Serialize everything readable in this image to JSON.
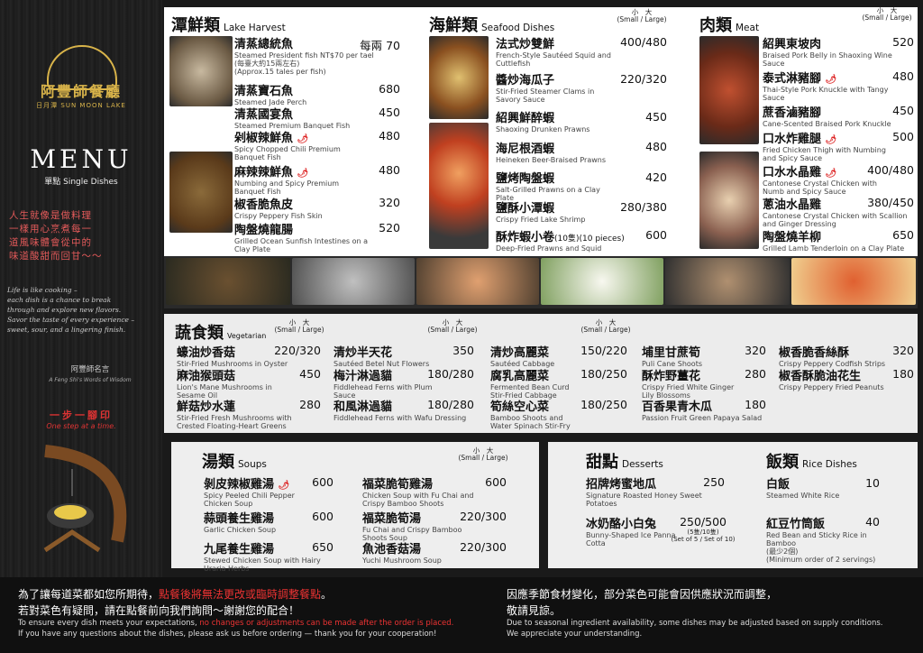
{
  "brand": {
    "name": "阿豐師餐廳",
    "sub": "日月潭 SUN MOON LAKE"
  },
  "menu": {
    "title": "MENU",
    "subtitle": "單點 Single Dishes"
  },
  "poem": {
    "zh": [
      "人生就像是做料理",
      "一樣用心烹煮每一",
      "道風味體會從中的",
      "味道酸甜而回甘～～"
    ],
    "en": [
      "Life is like cooking –",
      "each dish is a chance to break",
      "through and explore new flavors.",
      "Savor the taste of every experience –",
      "sweet, sour, and a lingering finish."
    ]
  },
  "signature": {
    "zh": "阿豐師名言",
    "en": "A Feng Shi's Words of Wisdom"
  },
  "step": {
    "zh": "一步一腳印",
    "en": "One step at a time."
  },
  "sections": {
    "lake": {
      "title": "潭鮮類",
      "title_en": "Lake Harvest",
      "items": [
        {
          "name": "清蒸總統魚",
          "en": "Steamed President fish  NT$70 per tael",
          "price": "每兩 70",
          "note": "(每臺大約15兩左右)",
          "note_en": "(Approx.15 tales per fish)"
        },
        {
          "name": "清蒸寶石魚",
          "en": "Steamed Jade Perch",
          "price": "680"
        },
        {
          "name": "清蒸國宴魚",
          "en": "Steamed Premium Banquet Fish",
          "price": "450"
        },
        {
          "name": "剁椒辣鮮魚",
          "en": "Spicy Chopped Chili Premium Banquet Fish",
          "price": "480",
          "spicy": true
        },
        {
          "name": "麻辣辣鮮魚",
          "en": "Numbing and Spicy Premium Banquet Fish",
          "price": "480",
          "spicy": true
        },
        {
          "name": "椒香脆魚皮",
          "en": "Crispy Peppery Fish Skin",
          "price": "320"
        },
        {
          "name": "陶盤燒龍腸",
          "en": "Grilled Ocean Sunfish Intestines on a Clay Plate",
          "price": "520"
        }
      ]
    },
    "seafood": {
      "title": "海鮮類",
      "title_en": "Seafood Dishes",
      "size_header": [
        "小　大",
        "(Small / Large)"
      ],
      "items": [
        {
          "name": "法式炒雙鮮",
          "en": "French-Style Sautéed Squid and Cuttlefish",
          "price": "400/480"
        },
        {
          "name": "醬炒海瓜子",
          "en": "Stir-Fried Steamer Clams in Savory Sauce",
          "price": "220/320"
        },
        {
          "name": "紹興鮮醉蝦",
          "en": "Shaoxing Drunken Prawns",
          "price": "450"
        },
        {
          "name": "海尼根酒蝦",
          "en": "Heineken Beer-Braised Prawns",
          "price": "480"
        },
        {
          "name": "鹽烤陶盤蝦",
          "en": "Salt-Grilled Prawns on a Clay Plate",
          "price": "420"
        },
        {
          "name": "鹽酥小潭蝦",
          "en": "Crispy Fried Lake Shrimp",
          "price": "280/380"
        },
        {
          "name": "酥炸蝦小卷",
          "qty": "(10隻)(10 pieces)",
          "en": "Deep-Fried Prawns and Squid",
          "price": "600"
        }
      ]
    },
    "meat": {
      "title": "肉類",
      "title_en": "Meat",
      "size_header": [
        "小　大",
        "(Small / Large)"
      ],
      "items": [
        {
          "name": "紹興東坡肉",
          "en": "Braised Pork Belly in Shaoxing Wine Sauce",
          "price": "520"
        },
        {
          "name": "泰式淋豬腳",
          "en": "Thai-Style Pork Knuckle with Tangy Sauce",
          "price": "480",
          "spicy": true
        },
        {
          "name": "蔗香滷豬腳",
          "en": "Cane-Scented Braised Pork Knuckle",
          "price": "450"
        },
        {
          "name": "口水炸雞腿",
          "en": "Fried Chicken Thigh with Numbing and Spicy Sauce",
          "price": "500",
          "spicy": true
        },
        {
          "name": "口水水晶雞",
          "en": "Cantonese Crystal Chicken with Numb and Spicy Sauce",
          "price": "400/480",
          "spicy": true
        },
        {
          "name": "蔥油水晶雞",
          "en": "Cantonese Crystal Chicken with Scallion and Ginger Dressing",
          "price": "380/450"
        },
        {
          "name": "陶盤燒羊柳",
          "en": "Grilled Lamb Tenderloin on a Clay Plate",
          "price": "650"
        }
      ]
    },
    "veg": {
      "title": "蔬食類",
      "title_en": "Vegetarian",
      "size_header": [
        "小　大",
        "(Small / Large)"
      ],
      "items": [
        {
          "name": "蠔油炒香菇",
          "en": "Stir-Fried Mushrooms in Oyster Sauce",
          "price": "220/320"
        },
        {
          "name": "麻油猴頭菇",
          "en": "Lion's Mane Mushrooms in Sesame Oil",
          "price": "450"
        },
        {
          "name": "鮮菇炒水蓮",
          "en": "Stir-Fried Fresh Mushrooms with Crested Floating-Heart Greens",
          "price": "280"
        },
        {
          "name": "清炒半天花",
          "en": "Sautéed Betel Nut Flowers",
          "price": "350"
        },
        {
          "name": "梅汁淋過貓",
          "en": "Fiddlehead Ferns with Plum Sauce",
          "price": "180/280"
        },
        {
          "name": "和風淋過貓",
          "en": "Fiddlehead Ferns with Wafu Dressing",
          "price": "180/280"
        },
        {
          "name": "清炒高麗菜",
          "en": "Sautéed Cabbage",
          "price": "150/220"
        },
        {
          "name": "腐乳高麗菜",
          "en": "Fermented Bean Curd Stir-Fried Cabbage",
          "price": "180/250"
        },
        {
          "name": "筍絲空心菜",
          "en": "Bamboo Shoots and Water Spinach Stir-Fry",
          "price": "180/250"
        },
        {
          "name": "埔里甘蔗筍",
          "en": "Puli Cane Shoots",
          "price": "320"
        },
        {
          "name": "酥炸野薑花",
          "en": "Crispy Fried White Ginger Lily Blossoms",
          "price": "280"
        },
        {
          "name": "百香果青木瓜",
          "en": "Passion Fruit Green Papaya Salad",
          "price": "180"
        },
        {
          "name": "椒香脆香絲酥",
          "en": "Crispy Peppery Codfish Strips",
          "price": "320"
        },
        {
          "name": "椒香酥脆油花生",
          "en": "Crispy Peppery Fried Peanuts",
          "price": "180"
        }
      ]
    },
    "soup": {
      "title": "湯類",
      "title_en": "Soups",
      "size_header": [
        "小　大",
        "(Small / Large)"
      ],
      "items": [
        {
          "name": "剝皮辣椒雞湯",
          "en": "Spicy Peeled Chili Pepper Chicken Soup",
          "price": "600",
          "spicy": true
        },
        {
          "name": "蒜頭養生雞湯",
          "en": "Garlic Chicken Soup",
          "price": "600"
        },
        {
          "name": "九尾養生雞湯",
          "en": "Stewed Chicken Soup with Hairy Uraria Herbs",
          "price": "650"
        },
        {
          "name": "福菜脆筍雞湯",
          "en": "Chicken Soup with Fu Chai and Crispy Bamboo Shoots",
          "price": "600"
        },
        {
          "name": "福菜脆筍湯",
          "en": "Fu Chai and Crispy Bamboo Shoots Soup",
          "price": "220/300"
        },
        {
          "name": "魚池香菇湯",
          "en": "Yuchi Mushroom Soup",
          "price": "220/300"
        }
      ]
    },
    "dessert": {
      "title": "甜點",
      "title_en": "Desserts",
      "items": [
        {
          "name": "招牌烤蜜地瓜",
          "en": "Signature Roasted Honey Sweet Potatoes",
          "price": "250"
        },
        {
          "name": "冰奶酪小白兔",
          "en": "Bunny-Shaped Ice Panna Cotta",
          "price": "250/500",
          "qty": "(5隻/10隻)",
          "qty_en": "(Set of 5 / Set of 10)"
        }
      ]
    },
    "rice": {
      "title": "飯類",
      "title_en": "Rice Dishes",
      "items": [
        {
          "name": "白飯",
          "en": "Steamed White Rice",
          "price": "10"
        },
        {
          "name": "紅豆竹筒飯",
          "en": "Red Bean and Sticky Rice in Bamboo",
          "price": "40",
          "note": "(最少2個)",
          "note_en": "(Minimum order of 2 servings)"
        }
      ]
    }
  },
  "footer": {
    "l1a": "為了讓每道菜都如您所期待，",
    "l1b": "點餐後將無法更改或臨時調整餐點",
    "l1c": "。",
    "l2": "若對菜色有疑問，請在點餐前向我們詢問～謝謝您的配合！",
    "l3a": "To ensure every dish meets your expectations,",
    "l3b": "no changes or adjustments can be made after the order is placed.",
    "l4": "If you have any questions about the dishes, please ask us before ordering — thank you for your cooperation!",
    "r1": "因應季節食材變化，部分菜色可能會因供應狀況而調整，",
    "r2": "敬請見諒。",
    "r3": "Due to seasonal ingredient availability, some dishes may be adjusted based on supply conditions.",
    "r4": "We appreciate your understanding."
  },
  "colors": {
    "accent_red": "#d22222",
    "gold": "#d9b44a",
    "dark": "#1a1a1a"
  }
}
